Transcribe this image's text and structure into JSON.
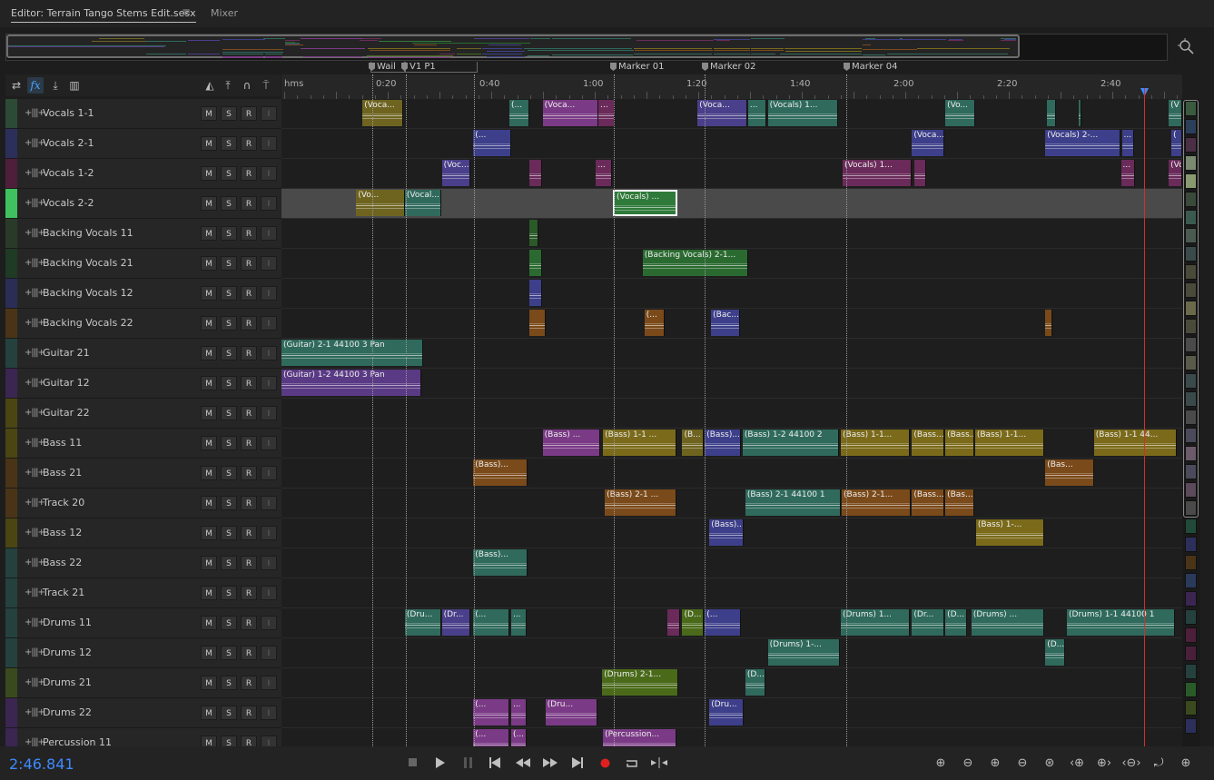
{
  "tabs": {
    "editor": "Editor: Terrain Tango Stems Edit.sesx",
    "menu": "≡",
    "mixer": "Mixer"
  },
  "ruler": {
    "unit": "hms",
    "labels": [
      "0:20",
      "0:40",
      "1:00",
      "1:20",
      "1:40",
      "2:00",
      "2:20",
      "2:40"
    ]
  },
  "markers": [
    "Wail",
    "V1 P1",
    "Marker 01",
    "Marker 02",
    "Marker 04"
  ],
  "track_buttons": {
    "mute": "M",
    "solo": "S",
    "record": "R",
    "input": "I"
  },
  "tracks": [
    {
      "name": "Vocals 1-1",
      "color": "#2c4a35"
    },
    {
      "name": "Vocals 2-1",
      "color": "#2c2f5a"
    },
    {
      "name": "Vocals 1-2",
      "color": "#4d1f3a"
    },
    {
      "name": "Vocals 2-2",
      "color": "#3ec15e"
    },
    {
      "name": "Backing Vocals 11",
      "color": "#2a3a28"
    },
    {
      "name": "Backing Vocals 21",
      "color": "#1f3a25"
    },
    {
      "name": "Backing Vocals 12",
      "color": "#2b2d55"
    },
    {
      "name": "Backing Vocals 22",
      "color": "#4a3418"
    },
    {
      "name": "Guitar 21",
      "color": "#24413e"
    },
    {
      "name": "Guitar 12",
      "color": "#3b2551"
    },
    {
      "name": "Guitar 22",
      "color": "#4a4512"
    },
    {
      "name": "Bass 11",
      "color": "#4a4512"
    },
    {
      "name": "Bass 21",
      "color": "#4a3418"
    },
    {
      "name": "Track 20",
      "color": "#4a3418"
    },
    {
      "name": "Bass 12",
      "color": "#4a4512"
    },
    {
      "name": "Bass 22",
      "color": "#24413e"
    },
    {
      "name": "Track 21",
      "color": "#24413e"
    },
    {
      "name": "Drums 11",
      "color": "#24413e"
    },
    {
      "name": "Drums 12",
      "color": "#24413e"
    },
    {
      "name": "Drums 21",
      "color": "#3a4a1e"
    },
    {
      "name": "Drums 22",
      "color": "#3b2551"
    },
    {
      "name": "Percussion 11",
      "color": "#3b2551"
    }
  ],
  "clips": [
    {
      "track": 0,
      "start": 0.09,
      "width": 0.045,
      "label": "(Voca...",
      "color": "#6e6420"
    },
    {
      "track": 0,
      "start": 0.253,
      "width": 0.022,
      "label": "(...",
      "color": "#2f6a5c"
    },
    {
      "track": 0,
      "start": 0.29,
      "width": 0.062,
      "label": "(Voca...",
      "color": "#7a3a85"
    },
    {
      "track": 0,
      "start": 0.352,
      "width": 0.018,
      "label": "...",
      "color": "#6a2a5a"
    },
    {
      "track": 0,
      "start": 0.462,
      "width": 0.055,
      "label": "(Voca...",
      "color": "#4a3f8a"
    },
    {
      "track": 0,
      "start": 0.518,
      "width": 0.02,
      "label": "...",
      "color": "#2f6a5c"
    },
    {
      "track": 0,
      "start": 0.54,
      "width": 0.078,
      "label": "(Vocals) 1...",
      "color": "#2f6a5c"
    },
    {
      "track": 0,
      "start": 0.737,
      "width": 0.033,
      "label": "(Vo...",
      "color": "#2f6a5c"
    },
    {
      "track": 0,
      "start": 0.85,
      "width": 0.01,
      "label": "",
      "color": "#2f6a5c"
    },
    {
      "track": 0,
      "start": 0.885,
      "width": 0.002,
      "label": "",
      "color": "#2f6a5c"
    },
    {
      "track": 0,
      "start": 0.985,
      "width": 0.015,
      "label": "(V",
      "color": "#2f6a5c"
    },
    {
      "track": 1,
      "start": 0.213,
      "width": 0.042,
      "label": "(...",
      "color": "#3d3f8a"
    },
    {
      "track": 1,
      "start": 0.7,
      "width": 0.036,
      "label": "(Voca...",
      "color": "#3d3f8a"
    },
    {
      "track": 1,
      "start": 0.848,
      "width": 0.083,
      "label": "(Vocals) 2-...",
      "color": "#3d3f8a"
    },
    {
      "track": 1,
      "start": 0.933,
      "width": 0.014,
      "label": "...",
      "color": "#3d3f8a"
    },
    {
      "track": 1,
      "start": 0.988,
      "width": 0.012,
      "label": "(",
      "color": "#3d3f8a"
    },
    {
      "track": 2,
      "start": 0.178,
      "width": 0.032,
      "label": "(Voc...",
      "color": "#4a3f8a"
    },
    {
      "track": 2,
      "start": 0.275,
      "width": 0.014,
      "label": "",
      "color": "#6a2a5a"
    },
    {
      "track": 2,
      "start": 0.349,
      "width": 0.018,
      "label": "...",
      "color": "#6a2a5a"
    },
    {
      "track": 2,
      "start": 0.623,
      "width": 0.077,
      "label": "(Vocals) 1...",
      "color": "#6a2a5a"
    },
    {
      "track": 2,
      "start": 0.703,
      "width": 0.013,
      "label": "",
      "color": "#6a2a5a"
    },
    {
      "track": 2,
      "start": 0.932,
      "width": 0.016,
      "label": "...",
      "color": "#6a2a5a"
    },
    {
      "track": 2,
      "start": 0.985,
      "width": 0.015,
      "label": "(Vo",
      "color": "#6a2a5a"
    },
    {
      "track": 3,
      "start": 0.083,
      "width": 0.054,
      "label": "(Vo...",
      "color": "#6e6420"
    },
    {
      "track": 3,
      "start": 0.137,
      "width": 0.04,
      "label": "(Vocal...",
      "color": "#2f6a5c"
    },
    {
      "track": 3,
      "start": 0.368,
      "width": 0.072,
      "label": "(Vocals) ...",
      "color": "#2f7a3a",
      "selected": true
    },
    {
      "track": 4,
      "start": 0.275,
      "width": 0.01,
      "label": "",
      "color": "#2a5a28"
    },
    {
      "track": 5,
      "start": 0.275,
      "width": 0.014,
      "label": "",
      "color": "#2a6a30"
    },
    {
      "track": 5,
      "start": 0.401,
      "width": 0.117,
      "label": "(Backing Vocals) 2-1...",
      "color": "#2a6a30"
    },
    {
      "track": 6,
      "start": 0.275,
      "width": 0.014,
      "label": "",
      "color": "#3d3f8a"
    },
    {
      "track": 7,
      "start": 0.275,
      "width": 0.018,
      "label": "",
      "color": "#7a4a1a"
    },
    {
      "track": 7,
      "start": 0.403,
      "width": 0.022,
      "label": "(...",
      "color": "#7a4a1a"
    },
    {
      "track": 7,
      "start": 0.477,
      "width": 0.032,
      "label": "(Bac...",
      "color": "#3d3f8a"
    },
    {
      "track": 7,
      "start": 0.848,
      "width": 0.008,
      "label": "",
      "color": "#7a4a1a"
    },
    {
      "track": 8,
      "start": 0.0,
      "width": 0.157,
      "label": "(Guitar) 2-1 44100 3         Pan",
      "color": "#2f6a5c"
    },
    {
      "track": 9,
      "start": 0.0,
      "width": 0.155,
      "label": "(Guitar) 1-2 44100 3         Pan",
      "color": "#5a3a85"
    },
    {
      "track": 11,
      "start": 0.29,
      "width": 0.064,
      "label": "(Bass) ...",
      "color": "#7a3a85"
    },
    {
      "track": 11,
      "start": 0.357,
      "width": 0.082,
      "label": "(Bass) 1-1 ...",
      "color": "#7a6a1a"
    },
    {
      "track": 11,
      "start": 0.445,
      "width": 0.024,
      "label": "(B...",
      "color": "#6e6420"
    },
    {
      "track": 11,
      "start": 0.47,
      "width": 0.04,
      "label": "(Bass)...",
      "color": "#3d3f8a"
    },
    {
      "track": 11,
      "start": 0.512,
      "width": 0.107,
      "label": "(Bass)  1-2 44100 2",
      "color": "#2f6a5c"
    },
    {
      "track": 11,
      "start": 0.621,
      "width": 0.077,
      "label": "(Bass) 1-1...",
      "color": "#7a6a1a"
    },
    {
      "track": 11,
      "start": 0.7,
      "width": 0.036,
      "label": "(Bass...",
      "color": "#7a6a1a"
    },
    {
      "track": 11,
      "start": 0.737,
      "width": 0.032,
      "label": "(Bass...",
      "color": "#7a6a1a"
    },
    {
      "track": 11,
      "start": 0.77,
      "width": 0.077,
      "label": "(Bass) 1-1...",
      "color": "#7a6a1a"
    },
    {
      "track": 11,
      "start": 0.902,
      "width": 0.092,
      "label": "(Bass) 1-1 44...",
      "color": "#7a6a1a"
    },
    {
      "track": 12,
      "start": 0.213,
      "width": 0.06,
      "label": "(Bass)...",
      "color": "#7a4a1a"
    },
    {
      "track": 12,
      "start": 0.848,
      "width": 0.054,
      "label": "(Bas...",
      "color": "#7a4a1a"
    },
    {
      "track": 13,
      "start": 0.359,
      "width": 0.08,
      "label": "(Bass) 2-1 ...",
      "color": "#7a4a1a"
    },
    {
      "track": 13,
      "start": 0.515,
      "width": 0.106,
      "label": "(Bass) 2-1 44100 1",
      "color": "#2f6a5c"
    },
    {
      "track": 13,
      "start": 0.622,
      "width": 0.077,
      "label": "(Bass) 2-1...",
      "color": "#7a4a1a"
    },
    {
      "track": 13,
      "start": 0.7,
      "width": 0.036,
      "label": "(Bass...",
      "color": "#7a4a1a"
    },
    {
      "track": 13,
      "start": 0.737,
      "width": 0.032,
      "label": "(Bas...",
      "color": "#7a4a1a"
    },
    {
      "track": 14,
      "start": 0.475,
      "width": 0.038,
      "label": "(Bass)...",
      "color": "#3d3f8a"
    },
    {
      "track": 14,
      "start": 0.771,
      "width": 0.076,
      "label": "(Bass)  1-...",
      "color": "#7a6a1a"
    },
    {
      "track": 15,
      "start": 0.213,
      "width": 0.06,
      "label": "(Bass)...",
      "color": "#2f6a5c"
    },
    {
      "track": 17,
      "start": 0.137,
      "width": 0.04,
      "label": "(Dru...",
      "color": "#2f6a5c"
    },
    {
      "track": 17,
      "start": 0.178,
      "width": 0.032,
      "label": "(Dr...",
      "color": "#4a3f8a"
    },
    {
      "track": 17,
      "start": 0.213,
      "width": 0.04,
      "label": "(...",
      "color": "#2f6a5c"
    },
    {
      "track": 17,
      "start": 0.255,
      "width": 0.017,
      "label": "...",
      "color": "#2f6a5c"
    },
    {
      "track": 17,
      "start": 0.428,
      "width": 0.015,
      "label": "",
      "color": "#6a2a5a"
    },
    {
      "track": 17,
      "start": 0.445,
      "width": 0.024,
      "label": "(D...",
      "color": "#4a6a1a"
    },
    {
      "track": 17,
      "start": 0.47,
      "width": 0.04,
      "label": "(...",
      "color": "#3d3f8a"
    },
    {
      "track": 17,
      "start": 0.621,
      "width": 0.077,
      "label": "(Drums) 1...",
      "color": "#2f6a5c"
    },
    {
      "track": 17,
      "start": 0.7,
      "width": 0.036,
      "label": "(Dr...",
      "color": "#2f6a5c"
    },
    {
      "track": 17,
      "start": 0.737,
      "width": 0.024,
      "label": "(D...",
      "color": "#2f6a5c"
    },
    {
      "track": 17,
      "start": 0.766,
      "width": 0.081,
      "label": "(Drums) ...",
      "color": "#2f6a5c"
    },
    {
      "track": 17,
      "start": 0.872,
      "width": 0.12,
      "label": "(Drums)  1-1 44100 1",
      "color": "#2f6a5c"
    },
    {
      "track": 18,
      "start": 0.54,
      "width": 0.08,
      "label": "(Drums) 1-...",
      "color": "#2f6a5c"
    },
    {
      "track": 18,
      "start": 0.848,
      "width": 0.022,
      "label": "(D...",
      "color": "#2f6a5c"
    },
    {
      "track": 19,
      "start": 0.356,
      "width": 0.085,
      "label": "(Drums) 2-1...",
      "color": "#4a6a1a"
    },
    {
      "track": 19,
      "start": 0.515,
      "width": 0.022,
      "label": "(D...",
      "color": "#2f6a5c"
    },
    {
      "track": 20,
      "start": 0.213,
      "width": 0.04,
      "label": "(...",
      "color": "#7a3a85"
    },
    {
      "track": 20,
      "start": 0.255,
      "width": 0.017,
      "label": "...",
      "color": "#7a3a85"
    },
    {
      "track": 20,
      "start": 0.293,
      "width": 0.058,
      "label": "(Dru...",
      "color": "#7a3a85"
    },
    {
      "track": 20,
      "start": 0.475,
      "width": 0.038,
      "label": "(Dru...",
      "color": "#3d3f8a"
    },
    {
      "track": 21,
      "start": 0.213,
      "width": 0.04,
      "label": "(...",
      "color": "#7a3a85"
    },
    {
      "track": 21,
      "start": 0.255,
      "width": 0.017,
      "label": "(...",
      "color": "#7a3a85"
    },
    {
      "track": 21,
      "start": 0.357,
      "width": 0.082,
      "label": "(Percussion...",
      "color": "#7a3a85"
    }
  ],
  "right_strip_colors": [
    "#3a5a40",
    "#2c3f5a",
    "#4a2f45",
    "#7a8a70",
    "#8a9a70",
    "#3a4a3a",
    "#3a5a50",
    "#4a5a50",
    "#3a4a4a",
    "#4a4a3a",
    "#4a4a3a",
    "#6a6a4a",
    "#4a4a3a",
    "#4a4a4a",
    "#5a5a4a",
    "#3a4a4a",
    "#3a4a4a",
    "#4a4a4a",
    "#4a4a5a",
    "#6a5a6a",
    "#4a4a5a",
    "#5a4a5a",
    "#4a4a4a",
    "#224a3a",
    "#2c2f5a",
    "#4a3418",
    "#2a3a5a",
    "#3b2551",
    "#24413e",
    "#4d1f3a",
    "#4a1f3a",
    "#24413e",
    "#2a5a28",
    "#3a4a1e",
    "#2c2f5a"
  ],
  "time_display": "2:46.841",
  "transport": [
    "stop",
    "play",
    "pause",
    "go-to-start",
    "rewind",
    "fast-forward",
    "go-to-end",
    "record",
    "loop",
    "skip"
  ],
  "zoom_tools": [
    "zoom-in-amplitude",
    "zoom-out-amplitude",
    "zoom-in",
    "zoom-out",
    "zoom-full",
    "zoom-in-left",
    "zoom-in-right",
    "zoom-out-full",
    "zoom-selection",
    "zoom-tracks"
  ]
}
